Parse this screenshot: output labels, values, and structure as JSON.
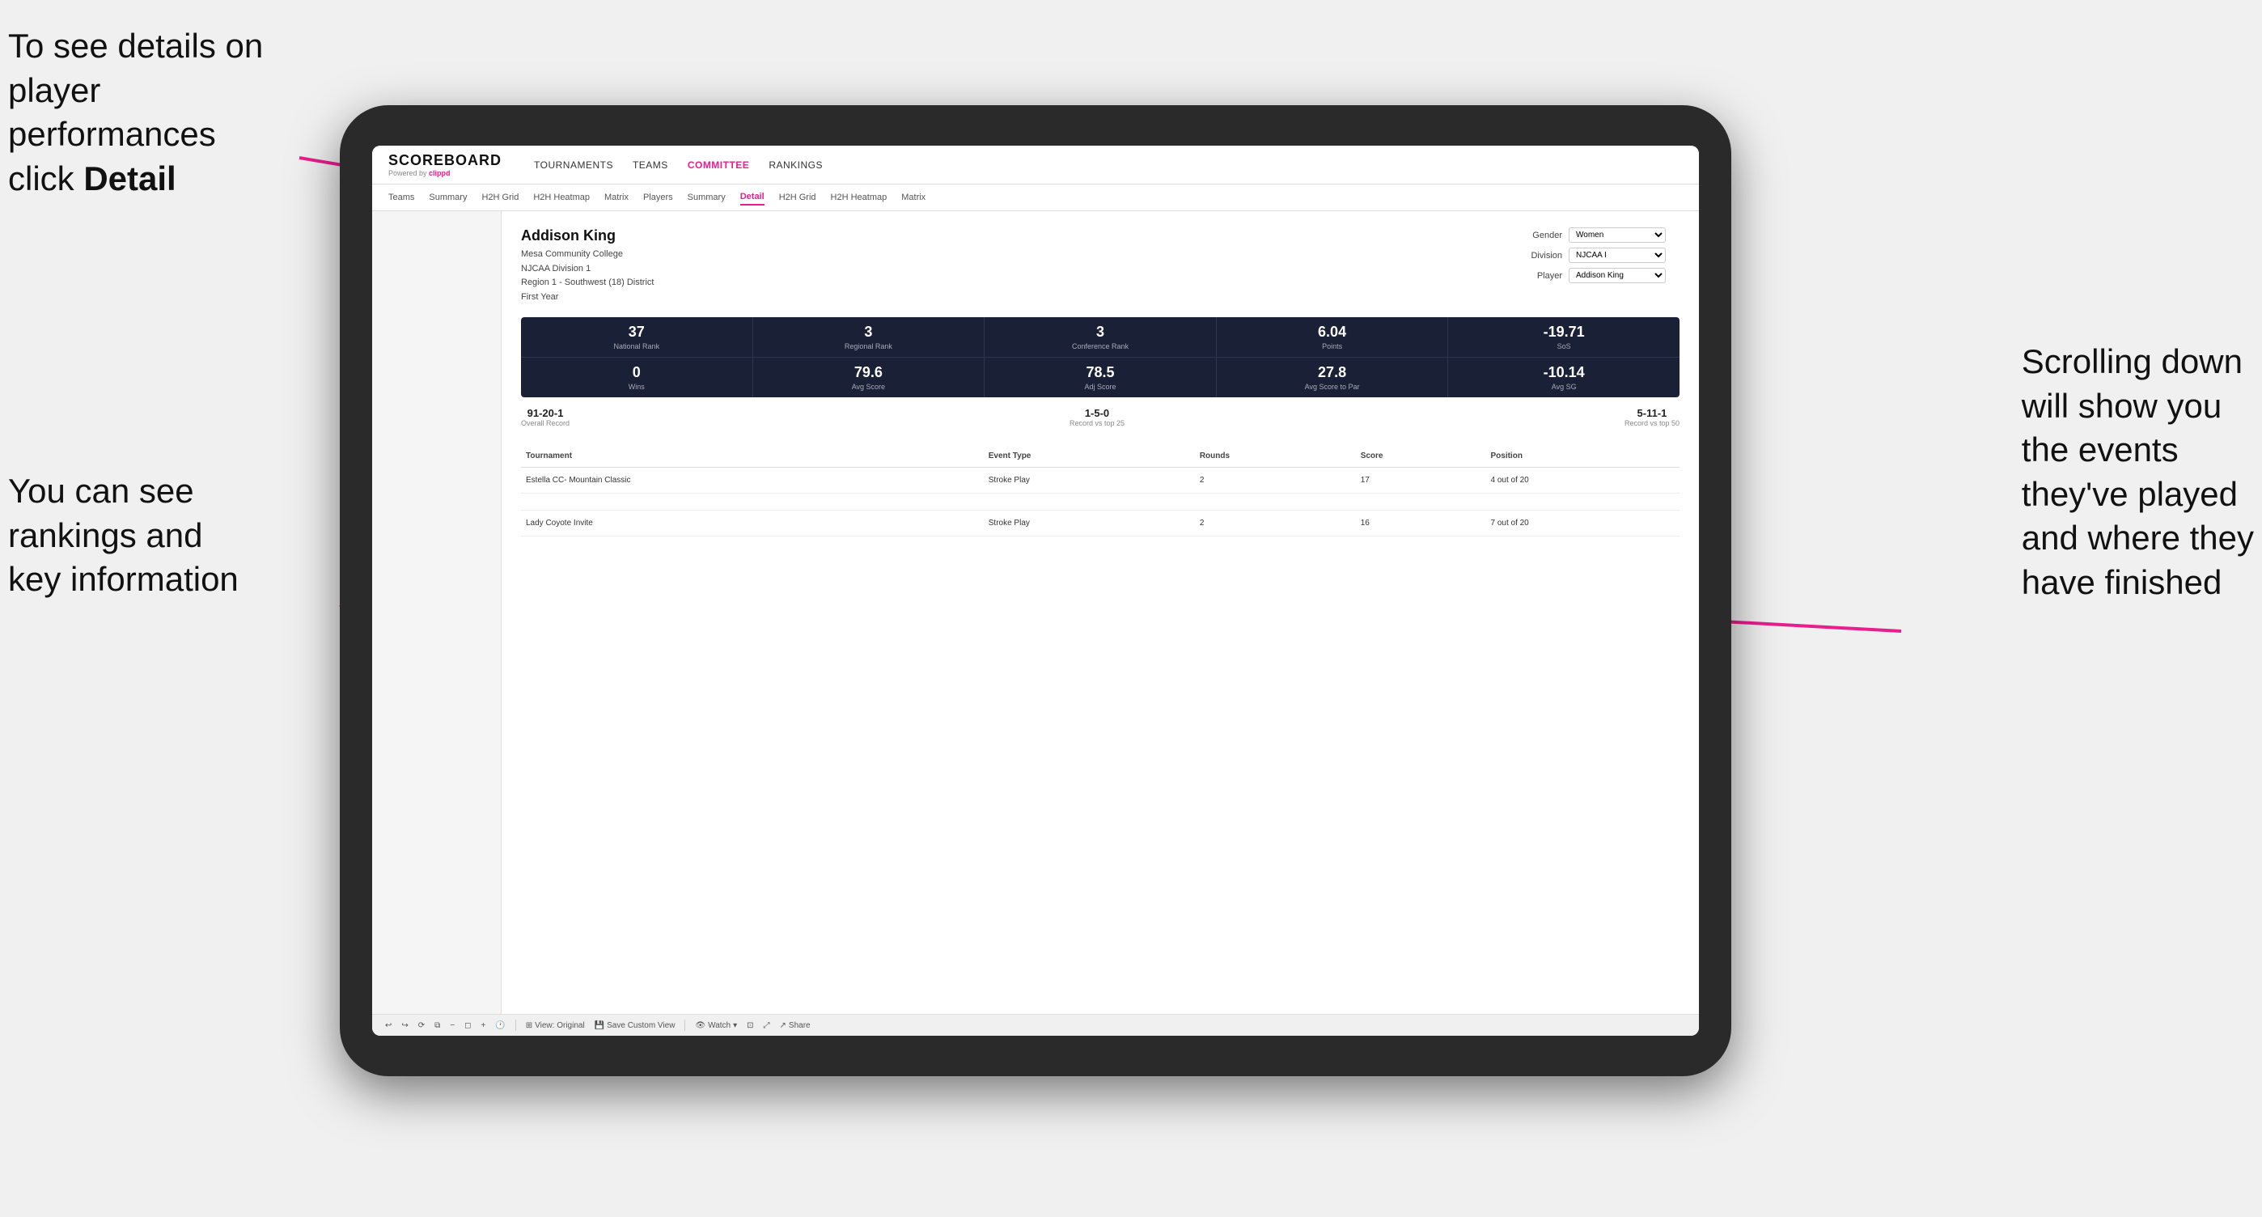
{
  "annotations": {
    "top_left_line1": "To see details on",
    "top_left_line2": "player performances",
    "top_left_line3": "click ",
    "top_left_bold": "Detail",
    "bottom_left_line1": "You can see",
    "bottom_left_line2": "rankings and",
    "bottom_left_line3": "key information",
    "right_line1": "Scrolling down",
    "right_line2": "will show you",
    "right_line3": "the events",
    "right_line4": "they've played",
    "right_line5": "and where they",
    "right_line6": "have finished"
  },
  "nav": {
    "logo_main": "SCOREBOARD",
    "logo_sub": "Powered by ",
    "logo_brand": "clippd",
    "items": [
      {
        "label": "TOURNAMENTS",
        "active": false
      },
      {
        "label": "TEAMS",
        "active": false
      },
      {
        "label": "COMMITTEE",
        "active": true
      },
      {
        "label": "RANKINGS",
        "active": false
      }
    ]
  },
  "subnav": {
    "items": [
      {
        "label": "Teams",
        "active": false
      },
      {
        "label": "Summary",
        "active": false
      },
      {
        "label": "H2H Grid",
        "active": false
      },
      {
        "label": "H2H Heatmap",
        "active": false
      },
      {
        "label": "Matrix",
        "active": false
      },
      {
        "label": "Players",
        "active": false
      },
      {
        "label": "Summary",
        "active": false
      },
      {
        "label": "Detail",
        "active": true
      },
      {
        "label": "H2H Grid",
        "active": false
      },
      {
        "label": "H2H Heatmap",
        "active": false
      },
      {
        "label": "Matrix",
        "active": false
      }
    ]
  },
  "player": {
    "name": "Addison King",
    "college": "Mesa Community College",
    "division": "NJCAA Division 1",
    "region": "Region 1 - Southwest (18) District",
    "year": "First Year"
  },
  "controls": {
    "gender_label": "Gender",
    "gender_value": "Women",
    "division_label": "Division",
    "division_value": "NJCAA I",
    "player_label": "Player",
    "player_value": "Addison King"
  },
  "stats_row1": [
    {
      "value": "37",
      "label": "National Rank"
    },
    {
      "value": "3",
      "label": "Regional Rank"
    },
    {
      "value": "3",
      "label": "Conference Rank"
    },
    {
      "value": "6.04",
      "label": "Points"
    },
    {
      "value": "-19.71",
      "label": "SoS"
    }
  ],
  "stats_row2": [
    {
      "value": "0",
      "label": "Wins"
    },
    {
      "value": "79.6",
      "label": "Avg Score"
    },
    {
      "value": "78.5",
      "label": "Adj Score"
    },
    {
      "value": "27.8",
      "label": "Avg Score to Par"
    },
    {
      "value": "-10.14",
      "label": "Avg SG"
    }
  ],
  "records": [
    {
      "value": "91-20-1",
      "label": "Overall Record"
    },
    {
      "value": "1-5-0",
      "label": "Record vs top 25"
    },
    {
      "value": "5-11-1",
      "label": "Record vs top 50"
    }
  ],
  "table": {
    "headers": [
      "Tournament",
      "Event Type",
      "Rounds",
      "Score",
      "Position"
    ],
    "rows": [
      {
        "tournament": "Estella CC- Mountain Classic",
        "event_type": "Stroke Play",
        "rounds": "2",
        "score": "17",
        "position": "4 out of 20"
      },
      {
        "tournament": "Lady Coyote Invite",
        "event_type": "Stroke Play",
        "rounds": "2",
        "score": "16",
        "position": "7 out of 20"
      }
    ]
  },
  "toolbar": {
    "view_label": "View: Original",
    "save_label": "Save Custom View",
    "watch_label": "Watch",
    "share_label": "Share"
  }
}
